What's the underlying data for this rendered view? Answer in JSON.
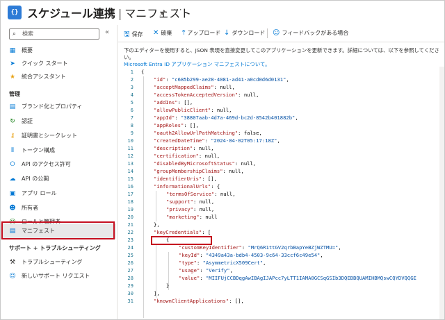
{
  "header": {
    "title": "スケジュール連携",
    "separator": "|",
    "subtitle": "マニフェスト",
    "app_icon_text": "{}",
    "pin_icon": "pin-icon",
    "more_icon": "ellipsis-icon"
  },
  "sidebar": {
    "search_placeholder": "検索",
    "collapse_glyph": "«",
    "items": [
      {
        "label": "概要",
        "icon": "grid-icon"
      },
      {
        "label": "クイック スタート",
        "icon": "rocket-icon"
      },
      {
        "label": "統合アシスタント",
        "icon": "assistant-icon"
      }
    ],
    "section_manage": "管理",
    "manage_items": [
      {
        "label": "ブランド化とプロパティ",
        "icon": "branding-icon"
      },
      {
        "label": "認証",
        "icon": "auth-icon"
      },
      {
        "label": "証明書とシークレット",
        "icon": "key-icon"
      },
      {
        "label": "トークン構成",
        "icon": "token-icon"
      },
      {
        "label": "API のアクセス許可",
        "icon": "api-permission-icon"
      },
      {
        "label": "API の公開",
        "icon": "cloud-icon"
      },
      {
        "label": "アプリ ロール",
        "icon": "app-roles-icon"
      },
      {
        "label": "所有者",
        "icon": "owners-icon"
      },
      {
        "label": "ロールと管理者",
        "icon": "roles-admin-icon"
      },
      {
        "label": "マニフェスト",
        "icon": "manifest-icon",
        "selected": true
      }
    ],
    "section_support": "サポート + トラブルシューティング",
    "support_items": [
      {
        "label": "トラブルシューティング",
        "icon": "wrench-icon"
      },
      {
        "label": "新しいサポート リクエスト",
        "icon": "support-icon"
      }
    ]
  },
  "toolbar": {
    "save": "保存",
    "discard": "破棄",
    "upload": "アップロード",
    "download": "ダウンロード",
    "feedback": "フィードバックがある場合"
  },
  "description": {
    "text": "下のエディターを使用すると、JSON 表現を直接変更してこのアプリケーションを更新できます。詳細については、以下を参照してください。",
    "link": "Microsoft Entra ID アプリケーション マニフェストについて。"
  },
  "editor": {
    "lines": [
      {
        "n": "1",
        "indent": 0,
        "parts": [
          [
            "p",
            "{"
          ]
        ]
      },
      {
        "n": "2",
        "indent": 1,
        "parts": [
          [
            "k",
            "\"id\""
          ],
          [
            "p",
            ": "
          ],
          [
            "s",
            "\"c685b299-ae28-4081-ad41-a0cd0d6d0131\""
          ],
          [
            "p",
            ","
          ]
        ]
      },
      {
        "n": "3",
        "indent": 1,
        "parts": [
          [
            "k",
            "\"acceptMappedClaims\""
          ],
          [
            "p",
            ": null,"
          ]
        ]
      },
      {
        "n": "4",
        "indent": 1,
        "parts": [
          [
            "k",
            "\"accessTokenAcceptedVersion\""
          ],
          [
            "p",
            ": null,"
          ]
        ]
      },
      {
        "n": "5",
        "indent": 1,
        "parts": [
          [
            "k",
            "\"addIns\""
          ],
          [
            "p",
            ": [],"
          ]
        ]
      },
      {
        "n": "6",
        "indent": 1,
        "parts": [
          [
            "k",
            "\"allowPublicClient\""
          ],
          [
            "p",
            ": null,"
          ]
        ]
      },
      {
        "n": "7",
        "indent": 1,
        "parts": [
          [
            "k",
            "\"appId\""
          ],
          [
            "p",
            ": "
          ],
          [
            "s",
            "\"38807aab-4d7a-469d-bc2d-8542b401882b\""
          ],
          [
            "p",
            ","
          ]
        ]
      },
      {
        "n": "8",
        "indent": 1,
        "parts": [
          [
            "k",
            "\"appRoles\""
          ],
          [
            "p",
            ": [],"
          ]
        ]
      },
      {
        "n": "9",
        "indent": 1,
        "parts": [
          [
            "k",
            "\"oauth2AllowUrlPathMatching\""
          ],
          [
            "p",
            ": false,"
          ]
        ]
      },
      {
        "n": "10",
        "indent": 1,
        "parts": [
          [
            "k",
            "\"createdDateTime\""
          ],
          [
            "p",
            ": "
          ],
          [
            "s",
            "\"2024-04-02T05:17:18Z\""
          ],
          [
            "p",
            ","
          ]
        ]
      },
      {
        "n": "11",
        "indent": 1,
        "parts": [
          [
            "k",
            "\"description\""
          ],
          [
            "p",
            ": null,"
          ]
        ]
      },
      {
        "n": "12",
        "indent": 1,
        "parts": [
          [
            "k",
            "\"certification\""
          ],
          [
            "p",
            ": null,"
          ]
        ]
      },
      {
        "n": "13",
        "indent": 1,
        "parts": [
          [
            "k",
            "\"disabledByMicrosoftStatus\""
          ],
          [
            "p",
            ": null,"
          ]
        ]
      },
      {
        "n": "14",
        "indent": 1,
        "parts": [
          [
            "k",
            "\"groupMembershipClaims\""
          ],
          [
            "p",
            ": null,"
          ]
        ]
      },
      {
        "n": "15",
        "indent": 1,
        "parts": [
          [
            "k",
            "\"identifierUris\""
          ],
          [
            "p",
            ": [],"
          ]
        ]
      },
      {
        "n": "16",
        "indent": 1,
        "parts": [
          [
            "k",
            "\"informationalUrls\""
          ],
          [
            "p",
            ": {"
          ]
        ]
      },
      {
        "n": "17",
        "indent": 2,
        "parts": [
          [
            "k",
            "\"termsOfService\""
          ],
          [
            "p",
            ": null,"
          ]
        ]
      },
      {
        "n": "18",
        "indent": 2,
        "parts": [
          [
            "k",
            "\"support\""
          ],
          [
            "p",
            ": null,"
          ]
        ]
      },
      {
        "n": "19",
        "indent": 2,
        "parts": [
          [
            "k",
            "\"privacy\""
          ],
          [
            "p",
            ": null,"
          ]
        ]
      },
      {
        "n": "20",
        "indent": 2,
        "parts": [
          [
            "k",
            "\"marketing\""
          ],
          [
            "p",
            ": null"
          ]
        ]
      },
      {
        "n": "21",
        "indent": 1,
        "parts": [
          [
            "p",
            "},"
          ]
        ]
      },
      {
        "n": "22",
        "indent": 1,
        "parts": [
          [
            "k",
            "\"keyCredentials\""
          ],
          [
            "p",
            ": ["
          ]
        ]
      },
      {
        "n": "23",
        "indent": 2,
        "parts": [
          [
            "p",
            "{"
          ]
        ]
      },
      {
        "n": "24",
        "indent": 3,
        "parts": [
          [
            "k",
            "\"customKeyIdentifier\""
          ],
          [
            "p",
            ": "
          ],
          [
            "s",
            "\"MrQ6R1ttGV2qrbBapYeBZjWZTMU=\""
          ],
          [
            "p",
            ","
          ]
        ]
      },
      {
        "n": "25",
        "indent": 3,
        "parts": [
          [
            "k",
            "\"keyId\""
          ],
          [
            "p",
            ": "
          ],
          [
            "s",
            "\"4349a43a-bdb4-4503-9c64-33ccf6c49e54\""
          ],
          [
            "p",
            ","
          ]
        ]
      },
      {
        "n": "26",
        "indent": 3,
        "parts": [
          [
            "k",
            "\"type\""
          ],
          [
            "p",
            ": "
          ],
          [
            "s",
            "\"AsymmetricX509Cert\""
          ],
          [
            "p",
            ","
          ]
        ]
      },
      {
        "n": "27",
        "indent": 3,
        "parts": [
          [
            "k",
            "\"usage\""
          ],
          [
            "p",
            ": "
          ],
          [
            "s",
            "\"Verify\""
          ],
          [
            "p",
            ","
          ]
        ]
      },
      {
        "n": "28",
        "indent": 3,
        "parts": [
          [
            "k",
            "\"value\""
          ],
          [
            "p",
            ": "
          ],
          [
            "s",
            "\"MIIFUjCCBDqgAwIBAgIJAPcc7yLTT1IAMA0GCSqGSIb3DQEBBQUAMIHBMQswCQYDVQQGE"
          ]
        ]
      },
      {
        "n": "29",
        "indent": 2,
        "parts": [
          [
            "p",
            "}"
          ]
        ]
      },
      {
        "n": "30",
        "indent": 1,
        "parts": [
          [
            "p",
            "],"
          ]
        ]
      },
      {
        "n": "31",
        "indent": 1,
        "parts": [
          [
            "k",
            "\"knownClientApplications\""
          ],
          [
            "p",
            ": [],"
          ]
        ]
      }
    ]
  },
  "colors": {
    "accent": "#0078d4",
    "highlight": "#c50f1f",
    "json_key": "#a31515",
    "json_string": "#0451a5",
    "line_number": "#237893"
  }
}
